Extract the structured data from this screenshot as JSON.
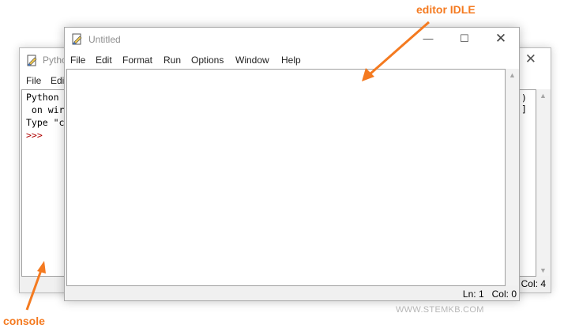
{
  "colors": {
    "annotation": "#f47a20",
    "prompt": "#b00000",
    "title_text": "#8f8f8f",
    "chrome": "#f0f0f0"
  },
  "annotations": {
    "editor_label": "editor IDLE",
    "console_label": "console"
  },
  "shell_window": {
    "title": "Pytho",
    "close_icon": "close-icon",
    "menu": [
      "File",
      "Edi"
    ],
    "lines": [
      "Python",
      " on wir",
      "Type \"c"
    ],
    "prompt": ">>>",
    "right_fragment": ") ]",
    "status": "Col: 4"
  },
  "editor_window": {
    "title": "Untitled",
    "controls": {
      "minimize": "—",
      "maximize": "☐",
      "close": "✕"
    },
    "menu": [
      "File",
      "Edit",
      "Format",
      "Run",
      "Options",
      "Window",
      "Help"
    ],
    "watermark": "WWW.STEMKB.COM",
    "status": {
      "ln": "Ln: 1",
      "col": "Col: 0"
    }
  }
}
